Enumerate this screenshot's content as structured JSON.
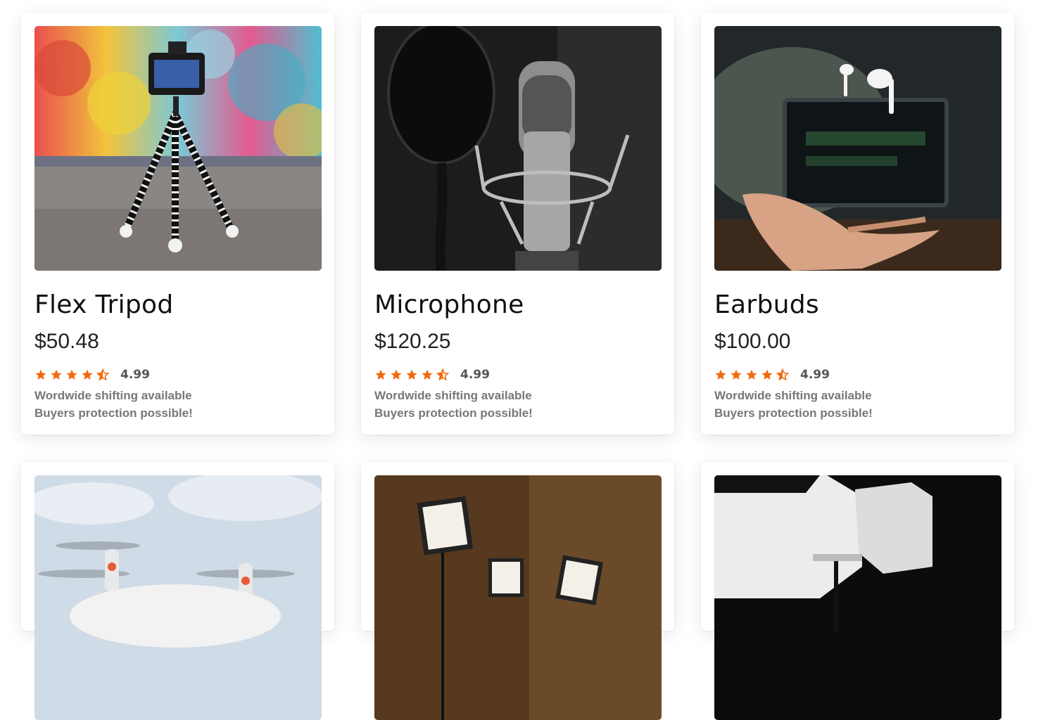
{
  "products": [
    {
      "name": "Flex Tripod",
      "price": "$50.48",
      "rating": "4.99",
      "stars": 4.5,
      "image_icon": "tripod-camera-photo",
      "shipping_text": "Wordwide shifting available",
      "protection_text": "Buyers protection possible!"
    },
    {
      "name": "Microphone",
      "price": "$120.25",
      "rating": "4.99",
      "stars": 4.5,
      "image_icon": "studio-microphone-photo",
      "shipping_text": "Wordwide shifting available",
      "protection_text": "Buyers protection possible!"
    },
    {
      "name": "Earbuds",
      "price": "$100.00",
      "rating": "4.99",
      "stars": 4.5,
      "image_icon": "earbuds-hand-photo",
      "shipping_text": "Wordwide shifting available",
      "protection_text": "Buyers protection possible!"
    },
    {
      "image_icon": "drone-photo"
    },
    {
      "image_icon": "led-panel-lights-photo"
    },
    {
      "image_icon": "studio-softbox-photo"
    }
  ],
  "colors": {
    "star": "#f26a10",
    "card_bg": "#ffffff",
    "title": "#111111",
    "info": "#777777"
  }
}
